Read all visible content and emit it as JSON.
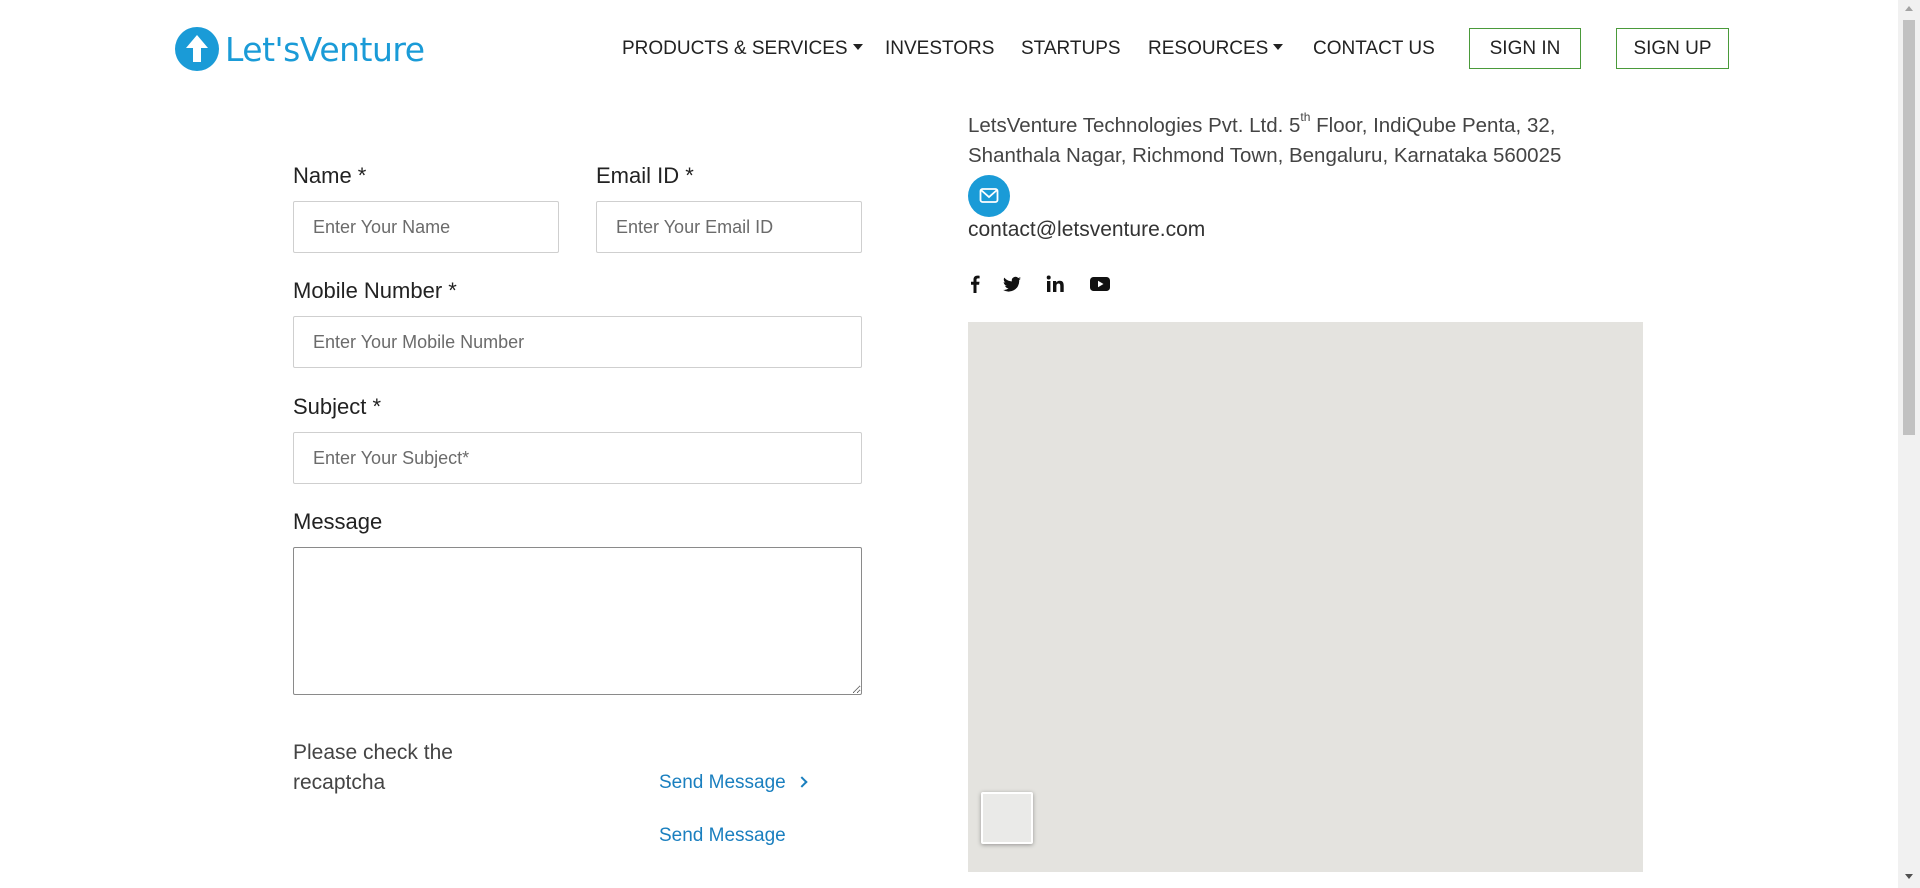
{
  "header": {
    "logo_text": "Let'sVenture",
    "nav": [
      {
        "label": "PRODUCTS & SERVICES",
        "dropdown": true
      },
      {
        "label": "INVESTORS",
        "dropdown": false
      },
      {
        "label": "STARTUPS",
        "dropdown": false
      },
      {
        "label": "RESOURCES",
        "dropdown": true
      },
      {
        "label": "CONTACT US",
        "dropdown": false
      }
    ],
    "sign_in": "SIGN IN",
    "sign_up": "SIGN UP",
    "accent_color": "#1a9bd7",
    "button_border_color": "#4a9a3a"
  },
  "form": {
    "name_label": "Name *",
    "name_placeholder": "Enter Your Name",
    "email_label": "Email ID *",
    "email_placeholder": "Enter Your Email ID",
    "mobile_label": "Mobile Number *",
    "mobile_placeholder": "Enter Your Mobile Number",
    "subject_label": "Subject *",
    "subject_placeholder": "Enter Your Subject*",
    "message_label": "Message",
    "captcha_note": "Please check the recaptcha",
    "send_message_1": "Send Message",
    "send_message_2": "Send Message"
  },
  "contact": {
    "address_pre": "LetsVenture Technologies Pvt. Ltd. 5",
    "address_sup": "th",
    "address_post": " Floor, IndiQube Penta, 32, Shanthala Nagar, Richmond Town, Bengaluru, Karnataka 560025",
    "email": "contact@letsventure.com",
    "social_icons": [
      "facebook-icon",
      "twitter-icon",
      "linkedin-icon",
      "youtube-icon"
    ]
  }
}
